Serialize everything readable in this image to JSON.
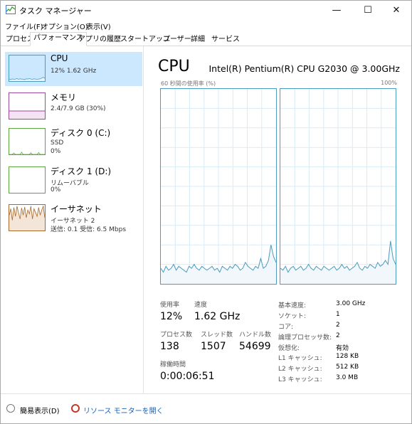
{
  "window": {
    "title": "タスク マネージャー",
    "minimize": "—",
    "maximize": "☐",
    "close": "✕"
  },
  "menu": [
    "ファイル(F)",
    "オプション(O)",
    "表示(V)"
  ],
  "tabs": [
    "プロセス",
    "パフォーマンス",
    "アプリの履歴",
    "スタートアップ",
    "ユーザー",
    "詳細",
    "サービス"
  ],
  "active_tab": "パフォーマンス",
  "sidebar": [
    {
      "name": "CPU",
      "sub1": "12%  1.62 GHz",
      "sub2": ""
    },
    {
      "name": "メモリ",
      "sub1": "2.4/7.9 GB (30%)",
      "sub2": ""
    },
    {
      "name": "ディスク 0 (C:)",
      "sub1": "SSD",
      "sub2": "0%"
    },
    {
      "name": "ディスク 1 (D:)",
      "sub1": "リムーバブル",
      "sub2": "0%"
    },
    {
      "name": "イーサネット",
      "sub1": "イーサネット 2",
      "sub2": "送信: 0.1  受信: 6.5 Mbps"
    }
  ],
  "colors": {
    "cpu": "#4a9bc0",
    "memory": "#9b4a9b",
    "disk": "#5aa53c",
    "ethernet": "#a76a2c",
    "selected": "#cce8ff"
  },
  "main": {
    "title": "CPU",
    "model": "Intel(R) Pentium(R) CPU G2030 @ 3.00GHz",
    "graph_label_left": "60 秒間の使用率 (%)",
    "graph_label_right": "100%"
  },
  "stats": {
    "usage_label": "使用率",
    "usage_value": "12%",
    "speed_label": "速度",
    "speed_value": "1.62 GHz",
    "process_label": "プロセス数",
    "process_value": "138",
    "thread_label": "スレッド数",
    "thread_value": "1507",
    "handle_label": "ハンドル数",
    "handle_value": "54699",
    "uptime_label": "稼働時間",
    "uptime_value": "0:00:06:51"
  },
  "specs": [
    {
      "label": "基本速度:",
      "value": "3.00 GHz"
    },
    {
      "label": "ソケット:",
      "value": "1"
    },
    {
      "label": "コア:",
      "value": "2"
    },
    {
      "label": "論理プロセッサ数:",
      "value": "2"
    },
    {
      "label": "仮想化:",
      "value": "有効"
    },
    {
      "label": "L1 キャッシュ:",
      "value": "128 KB"
    },
    {
      "label": "L2 キャッシュ:",
      "value": "512 KB"
    },
    {
      "label": "L3 キャッシュ:",
      "value": "3.0 MB"
    }
  ],
  "footer": {
    "fewer_details": "簡易表示(D)",
    "resource_monitor": "リソース モニターを開く"
  },
  "graph_series": {
    "core0": [
      8,
      6,
      9,
      7,
      8,
      10,
      7,
      9,
      8,
      7,
      6,
      9,
      8,
      10,
      8,
      7,
      9,
      8,
      7,
      8,
      9,
      7,
      8,
      6,
      9,
      8,
      7,
      9,
      8,
      10,
      9,
      7,
      8,
      11,
      9,
      8,
      7,
      9,
      8,
      13,
      8,
      9,
      12,
      20,
      14,
      11
    ],
    "core1": [
      8,
      7,
      9,
      6,
      8,
      9,
      7,
      8,
      9,
      7,
      8,
      10,
      8,
      7,
      9,
      8,
      7,
      9,
      8,
      7,
      8,
      9,
      7,
      8,
      10,
      8,
      9,
      7,
      8,
      9,
      11,
      8,
      7,
      9,
      8,
      10,
      9,
      8,
      11,
      9,
      10,
      12,
      10,
      22,
      13,
      10
    ]
  },
  "sidebar_series": {
    "cpu": [
      8,
      6,
      9,
      7,
      8,
      10,
      7,
      9,
      8,
      7,
      6,
      9,
      8,
      10,
      8,
      7,
      9,
      8,
      7,
      8,
      9,
      12,
      15,
      11
    ],
    "disk0": [
      0,
      0,
      0,
      5,
      0,
      0,
      0,
      0,
      8,
      0,
      0,
      0,
      0,
      0,
      6,
      0,
      0,
      0,
      0,
      7,
      0,
      0,
      0,
      0
    ],
    "ethernet": [
      60,
      85,
      40,
      90,
      55,
      95,
      70,
      45,
      88,
      60,
      92,
      50,
      80,
      65,
      95,
      45,
      85,
      70,
      55,
      90,
      60,
      80,
      95,
      50
    ]
  }
}
